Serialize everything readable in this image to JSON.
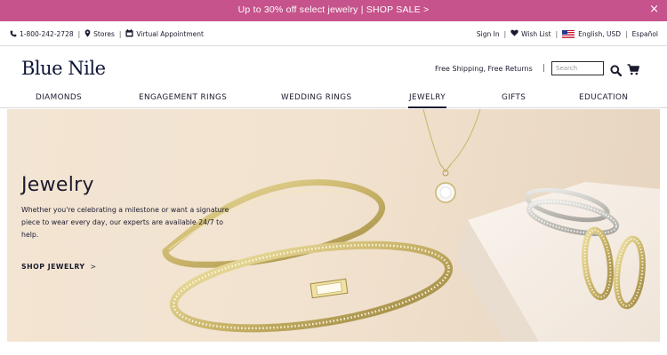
{
  "promo": {
    "text": "Up to 30% off select jewelry  |  SHOP SALE  >",
    "close": "×",
    "color": "#c6538b"
  },
  "utility": {
    "phone": "1-800-242-2728",
    "stores": "Stores",
    "appointment": "Virtual Appointment",
    "sign_in": "Sign In",
    "wish_list": "Wish List",
    "locale": "English, USD",
    "spanish": "Español",
    "separator": "|",
    "icons": [
      "phone-icon",
      "map-pin-icon",
      "calendar-icon",
      "heart-icon",
      "us-flag-icon"
    ]
  },
  "brand": {
    "logo": "Blue Nile",
    "shipping": "Free Shipping, Free Returns",
    "search_placeholder": "Search",
    "icons": [
      "search-icon",
      "cart-icon"
    ]
  },
  "nav": {
    "items": [
      {
        "label": "DIAMONDS"
      },
      {
        "label": "ENGAGEMENT RINGS"
      },
      {
        "label": "WEDDING RINGS"
      },
      {
        "label": "JEWELRY"
      },
      {
        "label": "GIFTS"
      },
      {
        "label": "EDUCATION"
      }
    ],
    "active": "JEWELRY"
  },
  "hero": {
    "title": "Jewelry",
    "description": "Whether you're celebrating a milestone or want a signature piece to wear every day, our experts are available 24/7 to help.",
    "cta": "SHOP JEWELRY",
    "cta_chevron": ">",
    "accent_gold": "#c9b46a"
  }
}
